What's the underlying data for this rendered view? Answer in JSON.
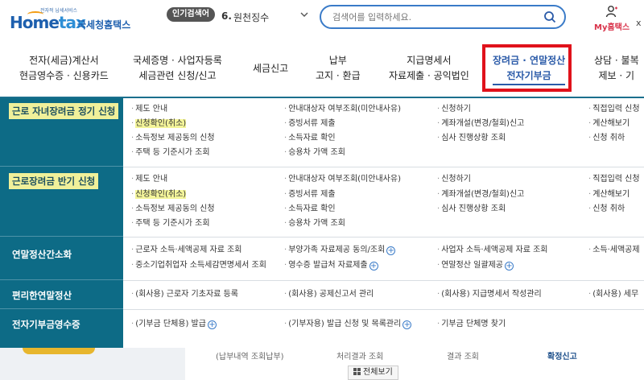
{
  "header": {
    "logo_tag": "전자적 납세서비스",
    "logo_home": "Home",
    "logo_tax": "tax",
    "logo_kr": "국세청홈택스",
    "popular_badge": "인기검색어",
    "popular_rank": "6.",
    "popular_term": "원천징수",
    "search_placeholder": "검색어를 입력하세요.",
    "my_label": "My홈택스",
    "close_label": "x"
  },
  "nav": [
    {
      "line1": "전자(세금)계산서",
      "line2": "현금영수증 · 신용카드"
    },
    {
      "line1": "국세증명 · 사업자등록",
      "line2": "세금관련 신청/신고"
    },
    {
      "line1": "세금신고",
      "line2": ""
    },
    {
      "line1": "납부",
      "line2": "고지 · 환급"
    },
    {
      "line1": "지급명세서",
      "line2": "자료제출 · 공익법인"
    },
    {
      "line1": "장려금 · 연말정산",
      "line2": "전자기부금"
    },
    {
      "line1": "상담 · 불복",
      "line2": "제보 · 기"
    }
  ],
  "menu": {
    "sections": [
      {
        "label": "근로 자녀장려금 정기 신청",
        "highlight": true,
        "columns": [
          [
            "제도 안내",
            "신청확인(취소)",
            "소득정보 제공동의 신청",
            "주택 등 기준시가 조회"
          ],
          [
            "안내대상자 여부조회(미안내사유)",
            "증빙서류 제출",
            "소득자료 확인",
            "승용차 가액 조회"
          ],
          [
            "신청하기",
            "계좌개설(변경/철회)신고",
            "심사 진행상황 조회"
          ],
          [
            "직접입력 신청",
            "계산해보기",
            "신청 취하"
          ]
        ]
      },
      {
        "label": "근로장려금 반기 신청",
        "highlight": true,
        "columns": [
          [
            "제도 안내",
            "신청확인(취소)",
            "소득정보 제공동의 신청",
            "주택 등 기준시가 조회"
          ],
          [
            "안내대상자 여부조회(미안내사유)",
            "증빙서류 제출",
            "소득자료 확인",
            "승용차 가액 조회"
          ],
          [
            "신청하기",
            "계좌개설(변경/철회)신고",
            "심사 진행상황 조회"
          ],
          [
            "직접입력 신청",
            "계산해보기",
            "신청 취하"
          ]
        ]
      },
      {
        "label": "연말정산간소화",
        "highlight": false,
        "columns": [
          [
            "근로자 소득·세액공제 자료 조회",
            "중소기업취업자 소득세감면명세서 조회"
          ],
          [
            "부양가족 자료제공 동의/조회",
            "영수증 발급처 자료제출"
          ],
          [
            "사업자 소득·세액공제 자료 조회",
            "연말정산 일괄제공"
          ],
          [
            "소득·세액공제"
          ]
        ]
      },
      {
        "label": "편리한연말정산",
        "highlight": false,
        "columns": [
          [
            "(회사용) 근로자 기초자료 등록"
          ],
          [
            "(회사용) 공제신고서 관리"
          ],
          [
            "(회사용) 지급명세서 작성관리"
          ],
          [
            "(회사용) 세무"
          ]
        ]
      },
      {
        "label": "전자기부금영수증",
        "highlight": false,
        "columns": [
          [
            "(기부금 단체용) 발급"
          ],
          [
            "(기부자용) 발급 신청 및 목록관리"
          ],
          [
            "기부금 단체명 찾기"
          ]
        ]
      }
    ]
  },
  "below": {
    "tabs": [
      "(납부내역 조회납부)",
      "처리결과 조회",
      "결과 조회",
      "확정신고"
    ],
    "view_all": "전체보기"
  }
}
